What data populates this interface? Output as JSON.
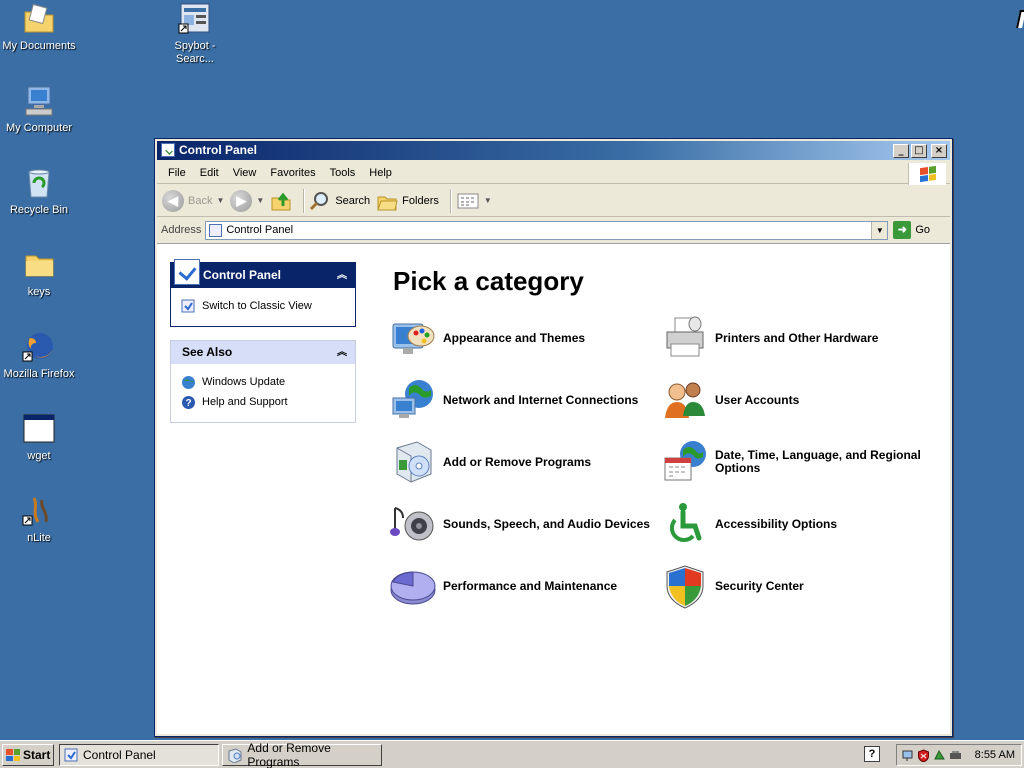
{
  "desktop": {
    "icons": [
      {
        "label": "My Documents",
        "icon": "folder-documents-icon"
      },
      {
        "label": "Spybot - Searc...",
        "icon": "spybot-shortcut-icon"
      },
      {
        "label": "My Computer",
        "icon": "computer-icon"
      },
      {
        "label": "Recycle Bin",
        "icon": "recycle-bin-icon"
      },
      {
        "label": "keys",
        "icon": "folder-icon"
      },
      {
        "label": "Mozilla Firefox",
        "icon": "firefox-icon"
      },
      {
        "label": "wget",
        "icon": "window-app-icon"
      },
      {
        "label": "nLite",
        "icon": "nlite-shortcut-icon"
      }
    ],
    "background": "#3a6ea5"
  },
  "window": {
    "title": "Control Panel",
    "controls": {
      "minimize": "_",
      "maximize": "□",
      "close": "×"
    },
    "menu": [
      "File",
      "Edit",
      "View",
      "Favorites",
      "Tools",
      "Help"
    ],
    "toolbar": {
      "back": "Back",
      "search": "Search",
      "folders": "Folders"
    },
    "address": {
      "label": "Address",
      "value": "Control Panel",
      "go": "Go"
    }
  },
  "sidebar": {
    "panel_title": "Control Panel",
    "switch_link": "Switch to Classic View",
    "see_also_title": "See Also",
    "see_also": [
      {
        "label": "Windows Update",
        "icon": "windows-update-icon"
      },
      {
        "label": "Help and Support",
        "icon": "help-icon"
      }
    ]
  },
  "main": {
    "heading": "Pick a category",
    "categories": [
      {
        "label": "Appearance and Themes",
        "icon": "appearance-icon"
      },
      {
        "label": "Printers and Other Hardware",
        "icon": "printer-icon"
      },
      {
        "label": "Network and Internet Connections",
        "icon": "network-icon"
      },
      {
        "label": "User Accounts",
        "icon": "users-icon"
      },
      {
        "label": "Add or Remove Programs",
        "icon": "add-remove-programs-icon"
      },
      {
        "label": "Date, Time, Language, and Regional Options",
        "icon": "date-time-icon"
      },
      {
        "label": "Sounds, Speech, and Audio Devices",
        "icon": "sound-icon"
      },
      {
        "label": "Accessibility Options",
        "icon": "accessibility-icon"
      },
      {
        "label": "Performance and Maintenance",
        "icon": "performance-icon"
      },
      {
        "label": "Security Center",
        "icon": "security-shield-icon"
      }
    ]
  },
  "taskbar": {
    "start": "Start",
    "tasks": [
      {
        "label": "Control Panel",
        "active": true
      },
      {
        "label": "Add or Remove Programs",
        "active": false
      }
    ],
    "help": "?",
    "clock": "8:55 AM"
  }
}
